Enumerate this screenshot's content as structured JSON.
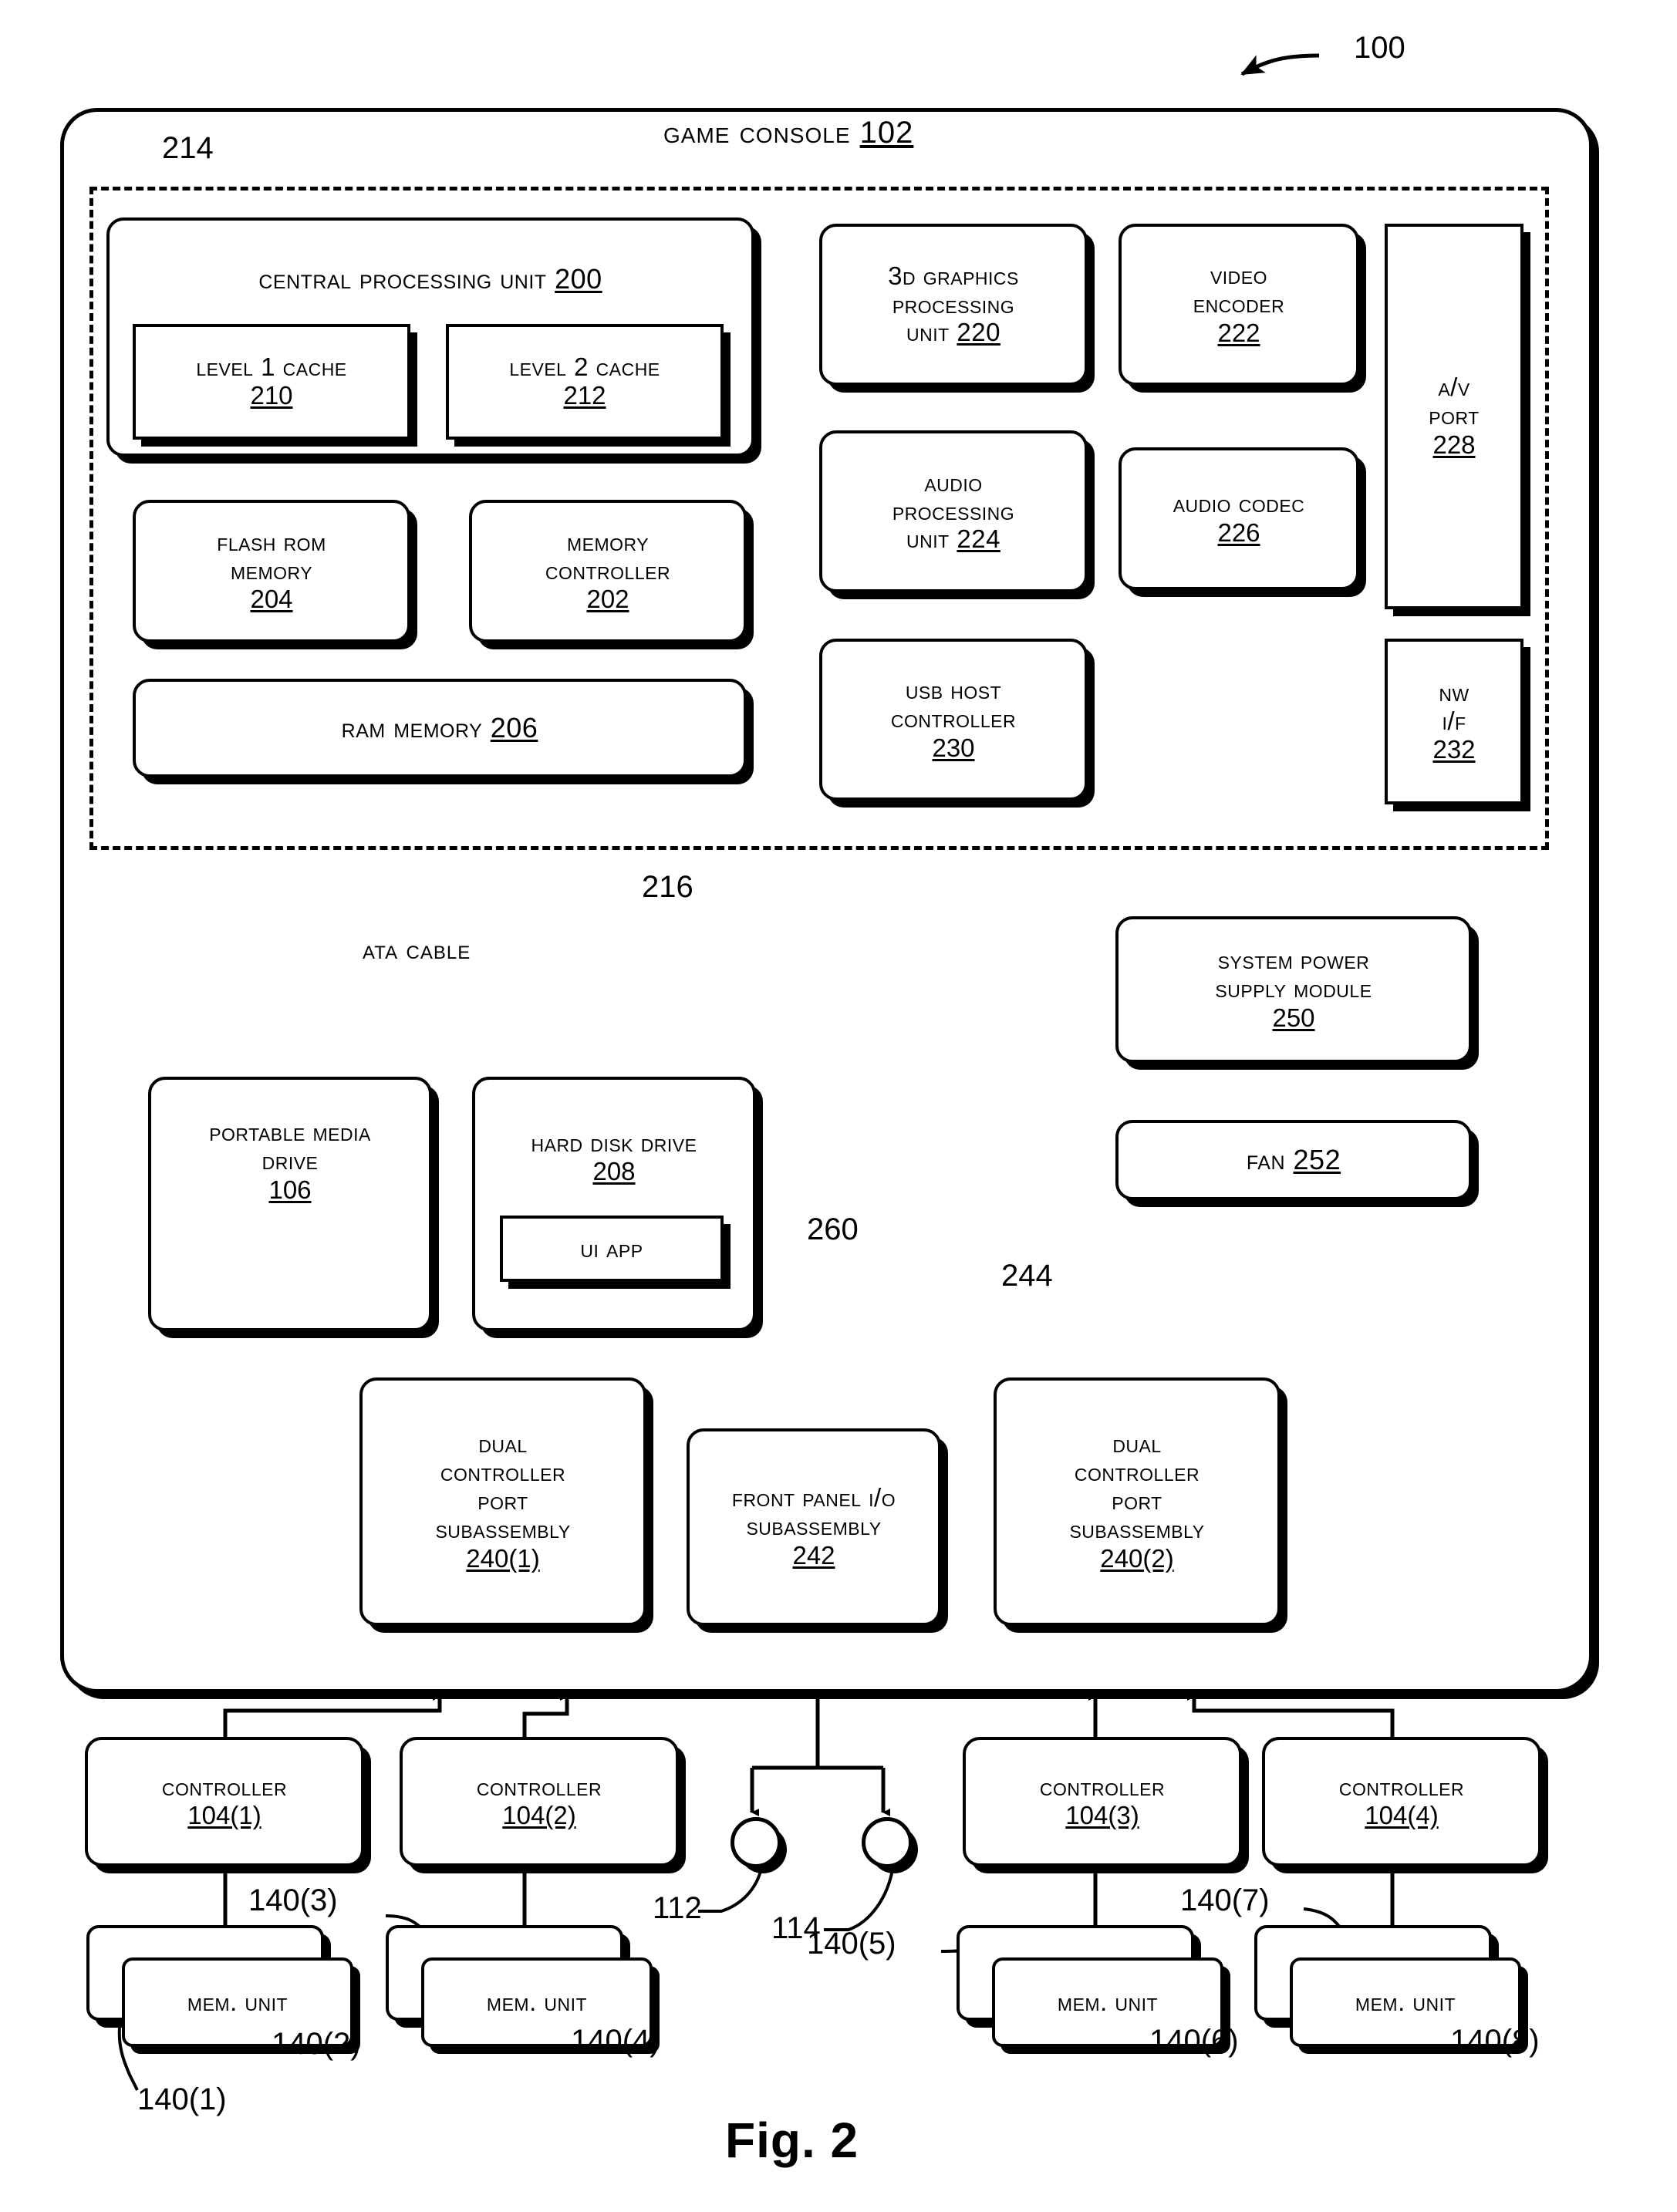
{
  "figure": {
    "caption": "Fig. 2",
    "system_ref": "100",
    "console_title": "Game Console",
    "console_ref": "102",
    "dashed_region_ref": "214",
    "ata_bus_ref": "216",
    "usb_bus_ref": "244",
    "ui_app_ref": "260"
  },
  "cpu": {
    "title": "Central Processing Unit",
    "ref": "200",
    "caches": [
      {
        "label": "Level 1 Cache",
        "ref": "210"
      },
      {
        "label": "Level 2 Cache",
        "ref": "212"
      }
    ]
  },
  "memory_blocks": [
    {
      "line1": "Flash ROM",
      "line2": "Memory",
      "ref": "204"
    },
    {
      "line1": "Memory",
      "line2": "Controller",
      "ref": "202"
    }
  ],
  "ram": {
    "label": "RAM Memory",
    "ref": "206"
  },
  "media_blocks": [
    {
      "line1": "3D Graphics",
      "line2": "Processing",
      "line3": "Unit",
      "ref": "220"
    },
    {
      "line1": "Video",
      "line2": "Encoder",
      "ref": "222"
    },
    {
      "line1": "Audio",
      "line2": "Processing",
      "line3": "Unit",
      "ref": "224"
    },
    {
      "line1": "Audio Codec",
      "ref": "226"
    },
    {
      "line1": "USB Host",
      "line2": "Controller",
      "ref": "230"
    }
  ],
  "ports": [
    {
      "line1": "A/V",
      "line2": "Port",
      "ref": "228"
    },
    {
      "line1": "NW",
      "line2": "I/F",
      "ref": "232"
    }
  ],
  "bus": {
    "label": "ATA Cable"
  },
  "drives": [
    {
      "line1": "Portable Media",
      "line2": "Drive",
      "ref": "106"
    },
    {
      "line1": "Hard Disk Drive",
      "ref": "208"
    }
  ],
  "ui_app": {
    "label": "UI App"
  },
  "power": [
    {
      "line1": "System Power",
      "line2": "Supply Module",
      "ref": "250"
    },
    {
      "line1": "Fan",
      "ref": "252"
    }
  ],
  "subassemblies": [
    {
      "line1": "Dual",
      "line2": "Controller",
      "line3": "Port",
      "line4": "Subassembly",
      "ref": "240(1)"
    },
    {
      "line1": "Front Panel I/O",
      "line2": "Subassembly",
      "ref": "242"
    },
    {
      "line1": "Dual",
      "line2": "Controller",
      "line3": "Port",
      "line4": "Subassembly",
      "ref": "240(2)"
    }
  ],
  "front_panel_ports": [
    {
      "ref": "112"
    },
    {
      "ref": "114"
    }
  ],
  "controllers": [
    {
      "label": "Controller",
      "ref": "104(1)"
    },
    {
      "label": "Controller",
      "ref": "104(2)"
    },
    {
      "label": "Controller",
      "ref": "104(3)"
    },
    {
      "label": "Controller",
      "ref": "104(4)"
    }
  ],
  "memory_units": [
    {
      "label": "Mem. Unit",
      "front_ref": "140(2)",
      "back_ref": "140(1)"
    },
    {
      "label": "Mem. Unit",
      "front_ref": "140(4)",
      "back_ref": "140(3)"
    },
    {
      "label": "Mem. Unit",
      "front_ref": "140(6)",
      "back_ref": "140(5)"
    },
    {
      "label": "Mem. Unit",
      "front_ref": "140(8)",
      "back_ref": "140(7)"
    }
  ]
}
